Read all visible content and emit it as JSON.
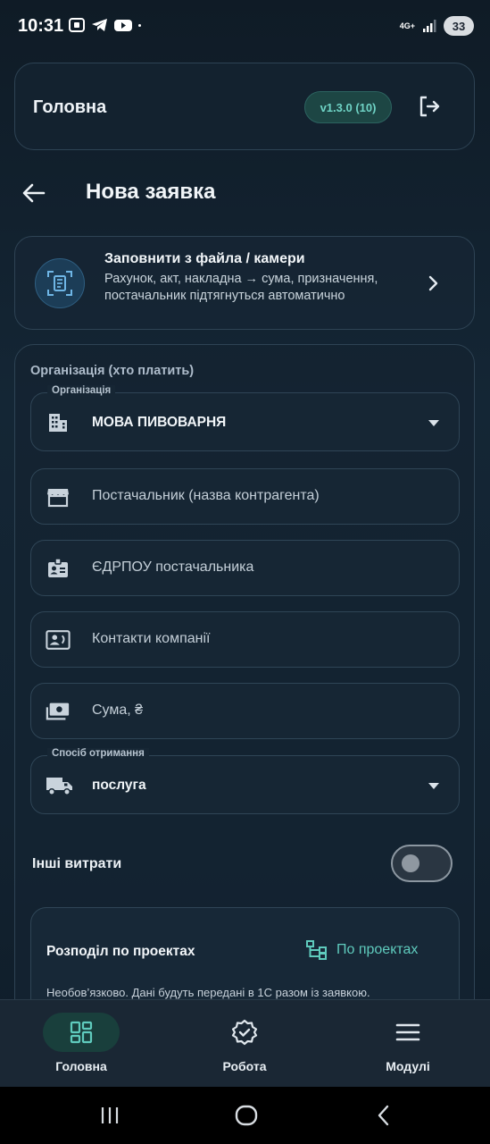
{
  "status_bar": {
    "time": "10:31",
    "network": "4G+",
    "battery": "33",
    "icons": [
      "screenshot-icon",
      "telegram-icon",
      "youtube-icon",
      "dot-icon",
      "signal-icon"
    ]
  },
  "header": {
    "title": "Головна",
    "version": "v1.3.0 (10)",
    "logout_icon": "logout-icon"
  },
  "page": {
    "title": "Нова заявка"
  },
  "fill_card": {
    "title": "Заповнити з файла / камери",
    "subtitle": "Рахунок, акт, накладна → сума, призначення, постачальник підтягнуться автоматично",
    "icon": "document-scan-icon"
  },
  "form": {
    "section_label": "Організація (хто платить)",
    "organization": {
      "label": "Організація",
      "value": "МОВА ПИВОВАРНЯ",
      "icon": "building-icon"
    },
    "supplier": {
      "placeholder": "Постачальник (назва контрагента)",
      "icon": "store-icon"
    },
    "edrpou": {
      "placeholder": "ЄДРПОУ постачальника",
      "icon": "id-badge-icon"
    },
    "contacts": {
      "placeholder": "Контакти компанії",
      "icon": "contact-card-icon"
    },
    "amount": {
      "placeholder": "Сума, ₴",
      "icon": "money-icon"
    },
    "receipt_method": {
      "label": "Спосіб отримання",
      "value": "послуга",
      "icon": "truck-icon"
    },
    "other_expenses": {
      "label": "Інші витрати",
      "enabled": false
    },
    "projects": {
      "title": "Розподіл по проектах",
      "button_label": "По проектах",
      "note": "Необов’язково. Дані будуть передані в 1С разом із заявкою."
    }
  },
  "bottom_nav": {
    "items": [
      {
        "label": "Головна",
        "icon": "dashboard-icon",
        "active": true
      },
      {
        "label": "Робота",
        "icon": "verified-badge-icon",
        "active": false
      },
      {
        "label": "Модулі",
        "icon": "menu-icon",
        "active": false
      }
    ]
  },
  "colors": {
    "accent": "#5fcbbd",
    "background": "#142635",
    "card_border": "#2e4354",
    "active_pill": "#193f3c"
  }
}
